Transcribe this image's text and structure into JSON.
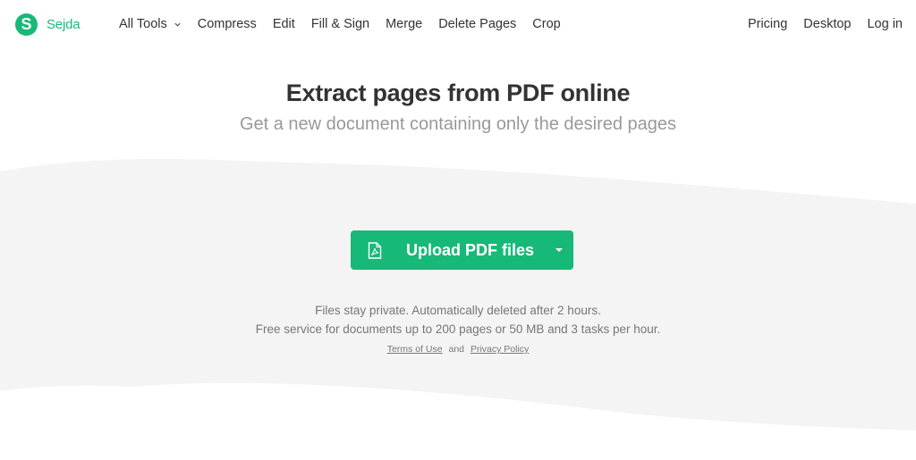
{
  "brand": {
    "logo_letter": "S",
    "name": "Sejda",
    "accent_color": "#17b978"
  },
  "nav": {
    "left_items": [
      {
        "label": "All Tools",
        "has_dropdown": true
      },
      {
        "label": "Compress"
      },
      {
        "label": "Edit"
      },
      {
        "label": "Fill & Sign"
      },
      {
        "label": "Merge"
      },
      {
        "label": "Delete Pages"
      },
      {
        "label": "Crop"
      }
    ],
    "right_items": [
      {
        "label": "Pricing"
      },
      {
        "label": "Desktop"
      },
      {
        "label": "Log in"
      }
    ]
  },
  "hero": {
    "title": "Extract pages from PDF online",
    "subtitle": "Get a new document containing only the desired pages"
  },
  "upload": {
    "label": "Upload PDF files",
    "icon": "pdf-file-icon",
    "dropdown_icon": "caret-down-icon"
  },
  "info": {
    "privacy_line": "Files stay private. Automatically deleted after 2 hours.",
    "limits_line": "Free service for documents up to 200 pages or 50 MB and 3 tasks per hour.",
    "terms_label": "Terms of Use",
    "and_label": "and",
    "privacy_label": "Privacy Policy"
  }
}
